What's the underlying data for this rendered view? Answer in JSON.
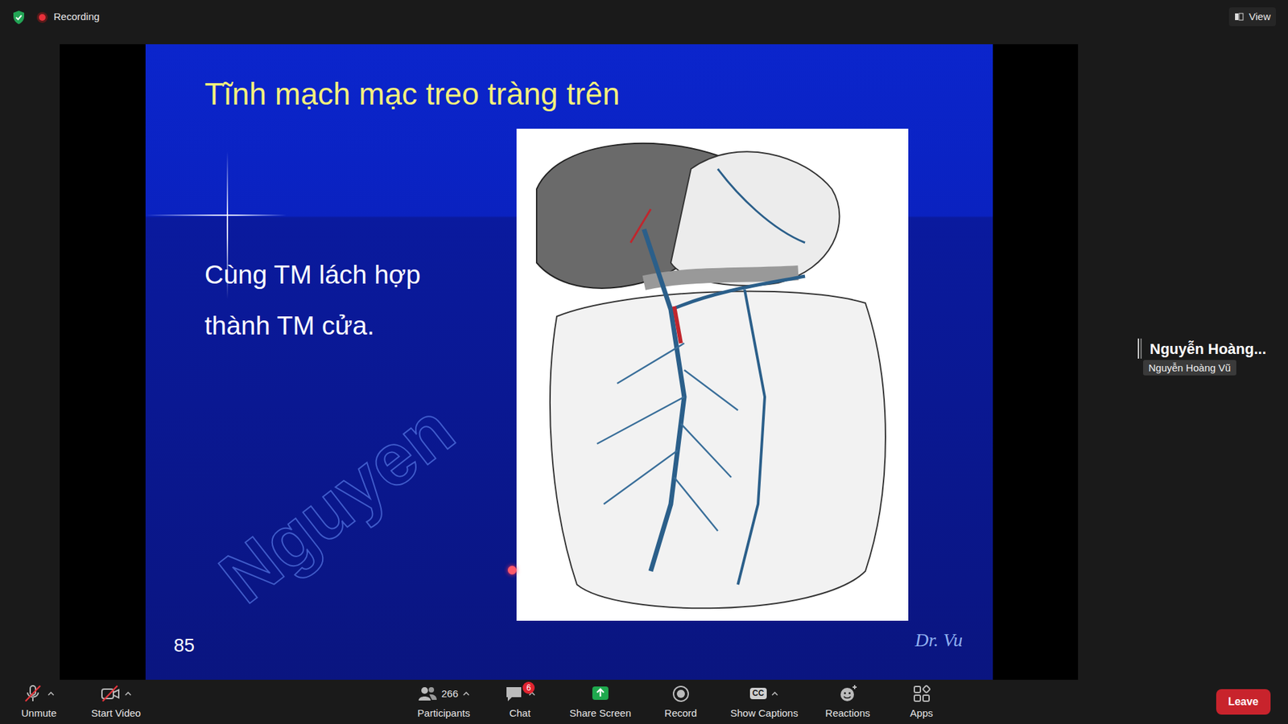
{
  "meeting": {
    "recording_label": "Recording",
    "view_label": "View"
  },
  "slide": {
    "title": "Tĩnh mạch mạc treo tràng trên",
    "body_lines": [
      "Cùng TM lách hợp",
      "thành TM cửa."
    ],
    "page_number": "85",
    "author": "Dr. Vu",
    "watermark": "Nguyen"
  },
  "speaker": {
    "name": "Nguyễn Hoàng...",
    "tooltip": "Nguyễn Hoàng Vũ"
  },
  "toolbar": [
    {
      "label": "Unmute",
      "kind": "mic",
      "off": true,
      "menu": true
    },
    {
      "label": "Start Video",
      "kind": "video",
      "off": true,
      "menu": true
    },
    {
      "label": "Participants",
      "kind": "people",
      "count": "266",
      "off": false,
      "menu": true
    },
    {
      "label": "Chat",
      "kind": "chat",
      "badge": "6",
      "off": false,
      "menu": true
    },
    {
      "label": "Share Screen",
      "kind": "share",
      "off": false,
      "menu": false
    },
    {
      "label": "Record",
      "kind": "record",
      "off": false,
      "menu": false
    },
    {
      "label": "Show Captions",
      "kind": "captions",
      "icon_text": "CC",
      "off": false,
      "menu": true
    },
    {
      "label": "Reactions",
      "kind": "reactions",
      "off": false,
      "menu": false
    },
    {
      "label": "Apps",
      "kind": "apps",
      "off": false,
      "menu": false
    }
  ],
  "leave_button": "Leave"
}
